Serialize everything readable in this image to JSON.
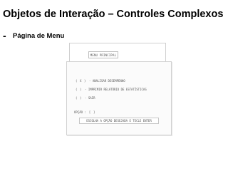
{
  "slide": {
    "title": "Objetos de Interação – Controles Complexos",
    "bullet_marker": "-",
    "bullet_text": "Página de Menu"
  },
  "screen": {
    "title": "MENU PRINCIPAL",
    "options": [
      {
        "checkbox": "( X )",
        "label": "- ANALISAR DESEMPENHO"
      },
      {
        "checkbox": "(   )",
        "label": "- IMPRIMIR RELATÓRIO DE ESTATÍSTICAS"
      },
      {
        "checkbox": "(   )",
        "label": "- SAIR"
      }
    ],
    "option_label": "OPÇÃO :",
    "option_value": "[  ]",
    "hint": "ESCOLHA A OPÇÃO DESEJADA E TECLE ENTER"
  }
}
